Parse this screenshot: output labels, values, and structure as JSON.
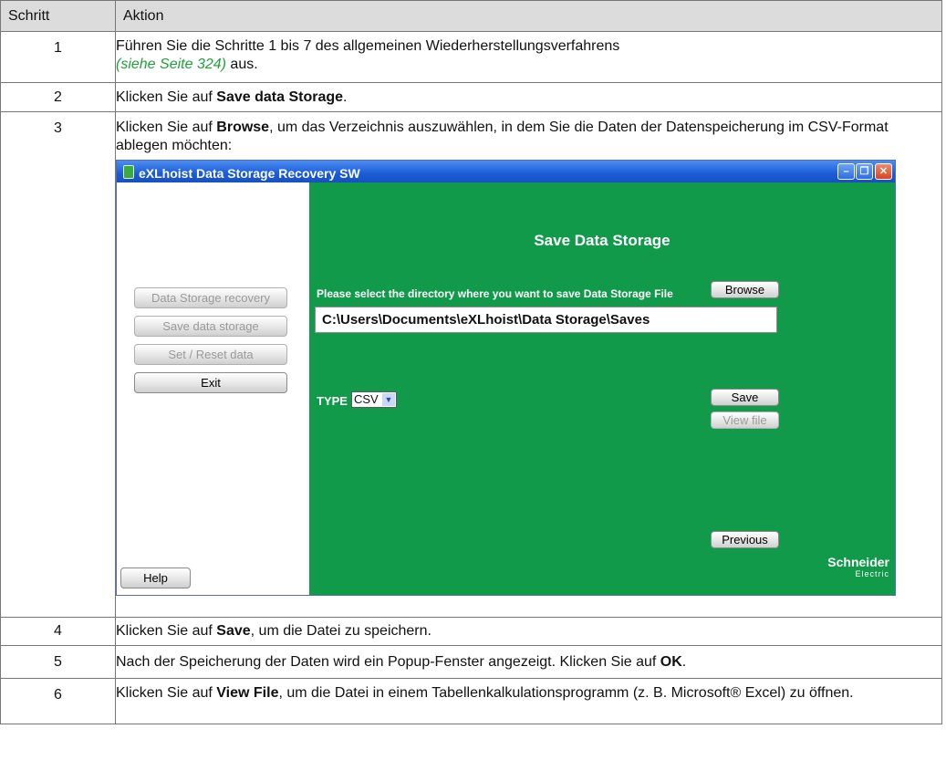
{
  "table": {
    "header_step": "Schritt",
    "header_action": "Aktion"
  },
  "rows": [
    {
      "step": "1",
      "text_a": "Führen Sie die Schritte 1 bis 7 des allgemeinen Wiederherstellungsverfahrens",
      "link": "(siehe Seite 324)",
      "text_b": " aus."
    },
    {
      "step": "2",
      "text_a": "Klicken Sie auf ",
      "bold": "Save data Storage",
      "text_b": "."
    },
    {
      "step": "3",
      "text_a": "Klicken Sie auf ",
      "bold": "Browse",
      "text_b": ", um das Verzeichnis auszuwählen, in dem Sie die Daten der Datenspeicherung im CSV-Format ablegen möchten:"
    },
    {
      "step": "4",
      "text_a": "Klicken Sie auf ",
      "bold": "Save",
      "text_b": ", um die Datei zu speichern."
    },
    {
      "step": "5",
      "text_a": "Nach der Speicherung der Daten wird ein Popup-Fenster angezeigt. Klicken Sie auf ",
      "bold": "OK",
      "text_b": "."
    },
    {
      "step": "6",
      "text_a": "Klicken Sie auf ",
      "bold": "View File",
      "text_b": ", um die Datei in einem Tabellenkalkulationsprogramm (z. B. Microsoft® Excel) zu öffnen."
    }
  ],
  "app": {
    "title": "eXLhoist Data Storage Recovery SW",
    "window_controls": {
      "minimize": "–",
      "maximize": "❐",
      "close": "✕"
    },
    "left_buttons": {
      "recovery": "Data Storage recovery",
      "save": "Save data storage",
      "set_reset": "Set / Reset data",
      "exit": "Exit",
      "help": "Help"
    },
    "screen_title": "Save Data Storage",
    "select_label": "Please select the directory where you want to save Data Storage File",
    "browse": "Browse",
    "path": "C:\\Users\\Documents\\eXLhoist\\Data Storage\\Saves",
    "type_label": "TYPE",
    "type_value": "CSV",
    "save": "Save",
    "view_file": "View file",
    "previous": "Previous",
    "brand_name": "Schneider",
    "brand_sub": "Electric",
    "colors": {
      "green": "#119a4a",
      "titlebar": "#1b5cd6",
      "link": "#1fa23b"
    }
  }
}
